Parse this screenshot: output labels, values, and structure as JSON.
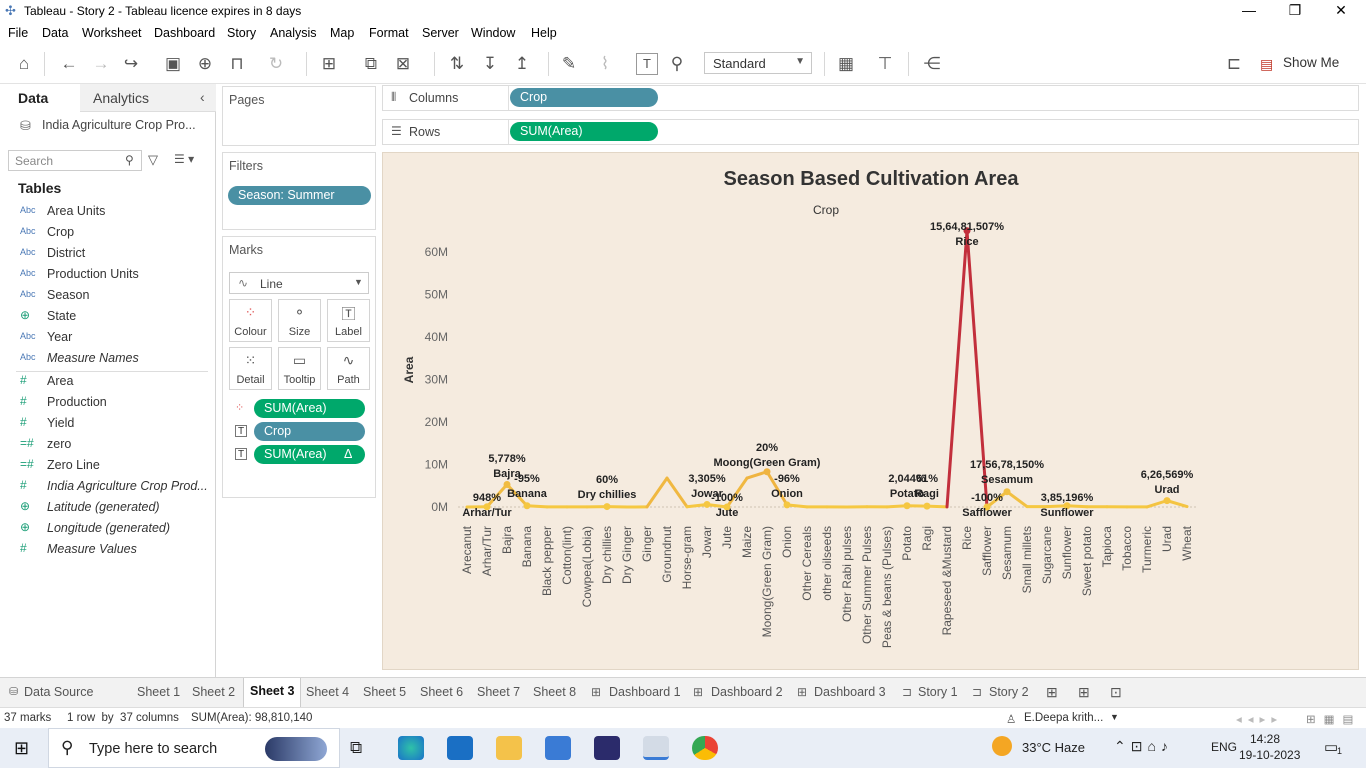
{
  "window": {
    "title": "Tableau - Story 2 - Tableau licence expires in 8 days"
  },
  "menu": [
    "File",
    "Data",
    "Worksheet",
    "Dashboard",
    "Story",
    "Analysis",
    "Map",
    "Format",
    "Server",
    "Window",
    "Help"
  ],
  "toolbar": {
    "fit_select": "Standard",
    "show_me": "Show Me"
  },
  "datapane": {
    "tab_data": "Data",
    "tab_analytics": "Analytics",
    "datasource": "India Agriculture Crop Pro...",
    "search_placeholder": "Search",
    "tables_heading": "Tables",
    "dimensions": [
      {
        "type": "Abc",
        "name": "Area Units"
      },
      {
        "type": "Abc",
        "name": "Crop"
      },
      {
        "type": "Abc",
        "name": "District"
      },
      {
        "type": "Abc",
        "name": "Production Units"
      },
      {
        "type": "Abc",
        "name": "Season"
      },
      {
        "type": "globe",
        "name": "State"
      },
      {
        "type": "Abc",
        "name": "Year"
      },
      {
        "type": "Abc",
        "name": "Measure Names"
      }
    ],
    "measures": [
      {
        "type": "#",
        "name": "Area"
      },
      {
        "type": "#",
        "name": "Production"
      },
      {
        "type": "#",
        "name": "Yield"
      },
      {
        "type": "=#",
        "name": "zero"
      },
      {
        "type": "=#",
        "name": "Zero Line"
      },
      {
        "type": "#",
        "name": "India Agriculture Crop Prod..."
      },
      {
        "type": "globe",
        "name": "Latitude (generated)"
      },
      {
        "type": "globe",
        "name": "Longitude (generated)"
      },
      {
        "type": "#",
        "name": "Measure Values"
      }
    ]
  },
  "cards": {
    "pages_title": "Pages",
    "filters_title": "Filters",
    "filter_pill": "Season: Summer",
    "marks_title": "Marks",
    "mark_type": "Line",
    "mark_buttons": [
      "Colour",
      "Size",
      "Label",
      "Detail",
      "Tooltip",
      "Path"
    ],
    "mark_pills": [
      "SUM(Area)",
      "Crop",
      "SUM(Area)"
    ],
    "mark_pill_delta": "Δ"
  },
  "shelves": {
    "columns_label": "Columns",
    "columns_pill": "Crop",
    "rows_label": "Rows",
    "rows_pill": "SUM(Area)"
  },
  "chart_data": {
    "type": "line",
    "title": "Season Based Cultivation Area",
    "x_header": "Crop",
    "ylabel": "Area",
    "ylim": [
      0,
      68000000
    ],
    "y_ticks": [
      "0M",
      "10M",
      "20M",
      "30M",
      "40M",
      "50M",
      "60M"
    ],
    "categories": [
      "Arecanut",
      "Arhar/Tur",
      "Bajra",
      "Banana",
      "Black pepper",
      "Cotton(lint)",
      "Cowpea(Lobia)",
      "Dry chillies",
      "Dry Ginger",
      "Ginger",
      "Groundnut",
      "Horse-gram",
      "Jowar",
      "Jute",
      "Maize",
      "Moong(Green Gram)",
      "Onion",
      "Other Cereals",
      "other oilseeds",
      "Other Rabi pulses",
      "Other Summer Pulses",
      "Peas & beans (Pulses)",
      "Potato",
      "Ragi",
      "Rapeseed &Mustard",
      "Rice",
      "Safflower",
      "Sesamum",
      "Small millets",
      "Sugarcane",
      "Sunflower",
      "Sweet potato",
      "Tapioca",
      "Tobacco",
      "Turmeric",
      "Urad",
      "Wheat"
    ],
    "values": [
      0,
      60000,
      5300000,
      300000,
      20000,
      40000,
      30000,
      100000,
      10000,
      20000,
      6800000,
      50000,
      600000,
      0,
      6800000,
      8300000,
      500000,
      30000,
      20000,
      10000,
      50000,
      20000,
      300000,
      200000,
      20000,
      65000000,
      0,
      3600000,
      100000,
      80000,
      300000,
      50000,
      60000,
      40000,
      20000,
      1500000,
      100000
    ],
    "labels": [
      {
        "crop": "Arhar/Tur",
        "pct": "948%",
        "name": "Arhar/Tur"
      },
      {
        "crop": "Bajra",
        "pct": "5,778%",
        "name": "Bajra"
      },
      {
        "crop": "Banana",
        "pct": "-95%",
        "name": "Banana"
      },
      {
        "crop": "Dry chillies",
        "pct": "60%",
        "name": "Dry chillies"
      },
      {
        "crop": "Jowar",
        "pct": "3,305%",
        "name": "Jowar"
      },
      {
        "crop": "Jute",
        "pct": "-100%",
        "name": "Jute"
      },
      {
        "crop": "Moong(Green Gram)",
        "pct": "20%",
        "name": "Moong(Green Gram)"
      },
      {
        "crop": "Onion",
        "pct": "-96%",
        "name": "Onion"
      },
      {
        "crop": "Potato",
        "pct": "2,044%",
        "name": "Potato"
      },
      {
        "crop": "Ragi",
        "pct": "61%",
        "name": "Ragi"
      },
      {
        "crop": "Rice",
        "pct": "15,64,81,507%",
        "name": "Rice"
      },
      {
        "crop": "Safflower",
        "pct": "-100%",
        "name": "Safflower"
      },
      {
        "crop": "Sesamum",
        "pct": "17,56,78,150%",
        "name": "Sesamum"
      },
      {
        "crop": "Sunflower",
        "pct": "3,85,196%",
        "name": "Sunflower"
      },
      {
        "crop": "Urad",
        "pct": "6,26,569%",
        "name": "Urad"
      }
    ],
    "colors": {
      "low": "#f5c842",
      "high": "#c0283c"
    },
    "grid": false
  },
  "sheets": [
    "Data Source",
    "Sheet 1",
    "Sheet 2",
    "Sheet 3",
    "Sheet 4",
    "Sheet 5",
    "Sheet 6",
    "Sheet 7",
    "Sheet 8",
    "Dashboard 1",
    "Dashboard 2",
    "Dashboard 3",
    "Story 1",
    "Story 2"
  ],
  "active_sheet": "Sheet 3",
  "status": {
    "marks": "37 marks",
    "dims": "1 row  by  37 columns",
    "sum": "SUM(Area): 98,810,140",
    "user": "E.Deepa krith..."
  },
  "taskbar": {
    "search": "Type here to search",
    "weather": "33°C  Haze",
    "lang": "ENG",
    "time": "14:28",
    "date": "19-10-2023",
    "notif": "1"
  }
}
